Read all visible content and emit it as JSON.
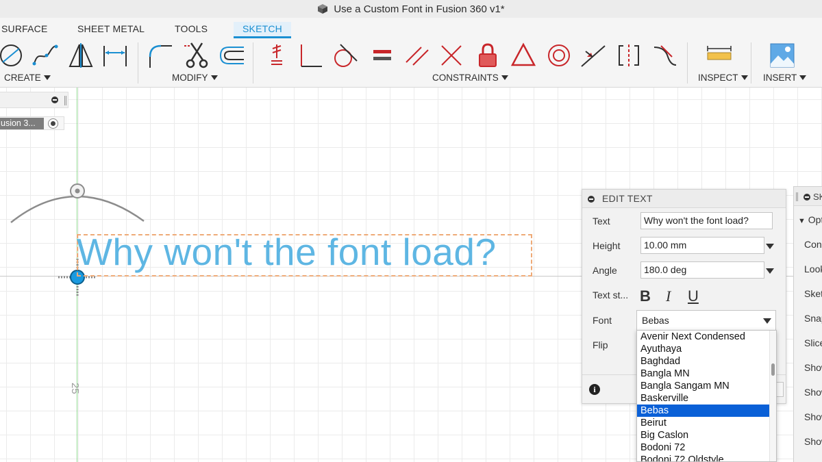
{
  "window": {
    "title": "Use a Custom Font in Fusion 360 v1*"
  },
  "tabs": [
    {
      "label": "SURFACE"
    },
    {
      "label": "SHEET METAL"
    },
    {
      "label": "TOOLS"
    },
    {
      "label": "SKETCH"
    }
  ],
  "groups": {
    "create": "CREATE",
    "modify": "MODIFY",
    "constraints": "CONSTRAINTS",
    "inspect": "INSPECT",
    "insert": "INSERT"
  },
  "browser": {
    "item_label": "usion 3..."
  },
  "sketch": {
    "text": "Why won't the font load?",
    "dimension": "25"
  },
  "edit_text": {
    "title": "EDIT TEXT",
    "text_label": "Text",
    "text_value": "Why won't the font load?",
    "height_label": "Height",
    "height_value": "10.00 mm",
    "angle_label": "Angle",
    "angle_value": "180.0 deg",
    "style_label": "Text st...",
    "bold": "B",
    "italic": "I",
    "underline": "U",
    "font_label": "Font",
    "font_value": "Bebas",
    "flip_label": "Flip",
    "info": "i"
  },
  "font_list": [
    "Avenir Next Condensed",
    "Ayuthaya",
    "Baghdad",
    "Bangla MN",
    "Bangla Sangam MN",
    "Baskerville",
    "Bebas",
    "Beirut",
    "Big Caslon",
    "Bodoni 72",
    "Bodoni 72 Oldstyle"
  ],
  "selected_font": "Bebas",
  "right_panel": {
    "header": "SK",
    "items": [
      "Opt",
      "Con",
      "Look",
      "Sket",
      "Snap",
      "Slice",
      "Show",
      "Show",
      "Show",
      "Show"
    ]
  },
  "colors": {
    "accent": "#1a8fd2",
    "constraint_red": "#c8262a",
    "sketch_text": "#5eb6e3",
    "selection": "#0a60d7"
  }
}
